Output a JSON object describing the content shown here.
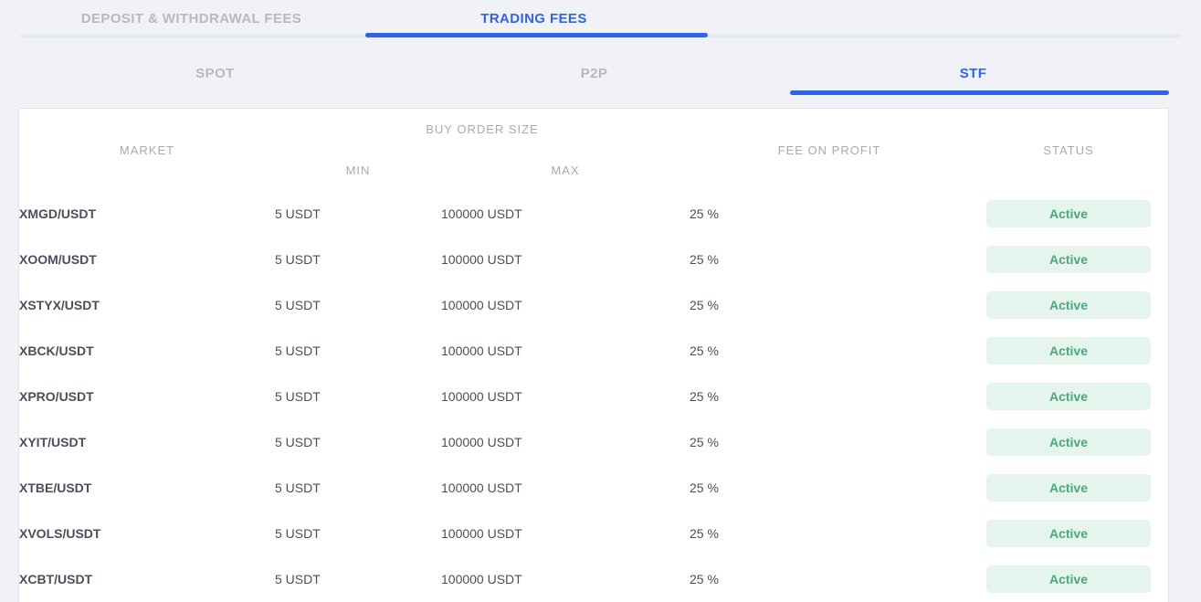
{
  "primary_tabs": [
    {
      "label": "DEPOSIT & WITHDRAWAL FEES",
      "active": false
    },
    {
      "label": "TRADING FEES",
      "active": true
    }
  ],
  "secondary_tabs": [
    {
      "label": "SPOT",
      "active": false
    },
    {
      "label": "P2P",
      "active": false
    },
    {
      "label": "STF",
      "active": true
    }
  ],
  "table": {
    "headers": {
      "market": "MARKET",
      "buy_order_size": "BUY ORDER SIZE",
      "min": "MIN",
      "max": "MAX",
      "fee_on_profit": "FEE ON PROFIT",
      "status": "STATUS"
    },
    "rows": [
      {
        "market": "XMGD/USDT",
        "min": "5 USDT",
        "max": "100000 USDT",
        "fee": "25 %",
        "status": "Active"
      },
      {
        "market": "XOOM/USDT",
        "min": "5 USDT",
        "max": "100000 USDT",
        "fee": "25 %",
        "status": "Active"
      },
      {
        "market": "XSTYX/USDT",
        "min": "5 USDT",
        "max": "100000 USDT",
        "fee": "25 %",
        "status": "Active"
      },
      {
        "market": "XBCK/USDT",
        "min": "5 USDT",
        "max": "100000 USDT",
        "fee": "25 %",
        "status": "Active"
      },
      {
        "market": "XPRO/USDT",
        "min": "5 USDT",
        "max": "100000 USDT",
        "fee": "25 %",
        "status": "Active"
      },
      {
        "market": "XYIT/USDT",
        "min": "5 USDT",
        "max": "100000 USDT",
        "fee": "25 %",
        "status": "Active"
      },
      {
        "market": "XTBE/USDT",
        "min": "5 USDT",
        "max": "100000 USDT",
        "fee": "25 %",
        "status": "Active"
      },
      {
        "market": "XVOLS/USDT",
        "min": "5 USDT",
        "max": "100000 USDT",
        "fee": "25 %",
        "status": "Active"
      },
      {
        "market": "XCBT/USDT",
        "min": "5 USDT",
        "max": "100000 USDT",
        "fee": "25 %",
        "status": "Active"
      }
    ]
  },
  "colors": {
    "accent": "#2f62ee",
    "page_background": "#f1f2f7",
    "inactive_tab_text": "#b6b9c4",
    "header_text": "#a9aab3",
    "status_active_text": "#4aa87b",
    "status_active_background": "#e5f4ec"
  }
}
